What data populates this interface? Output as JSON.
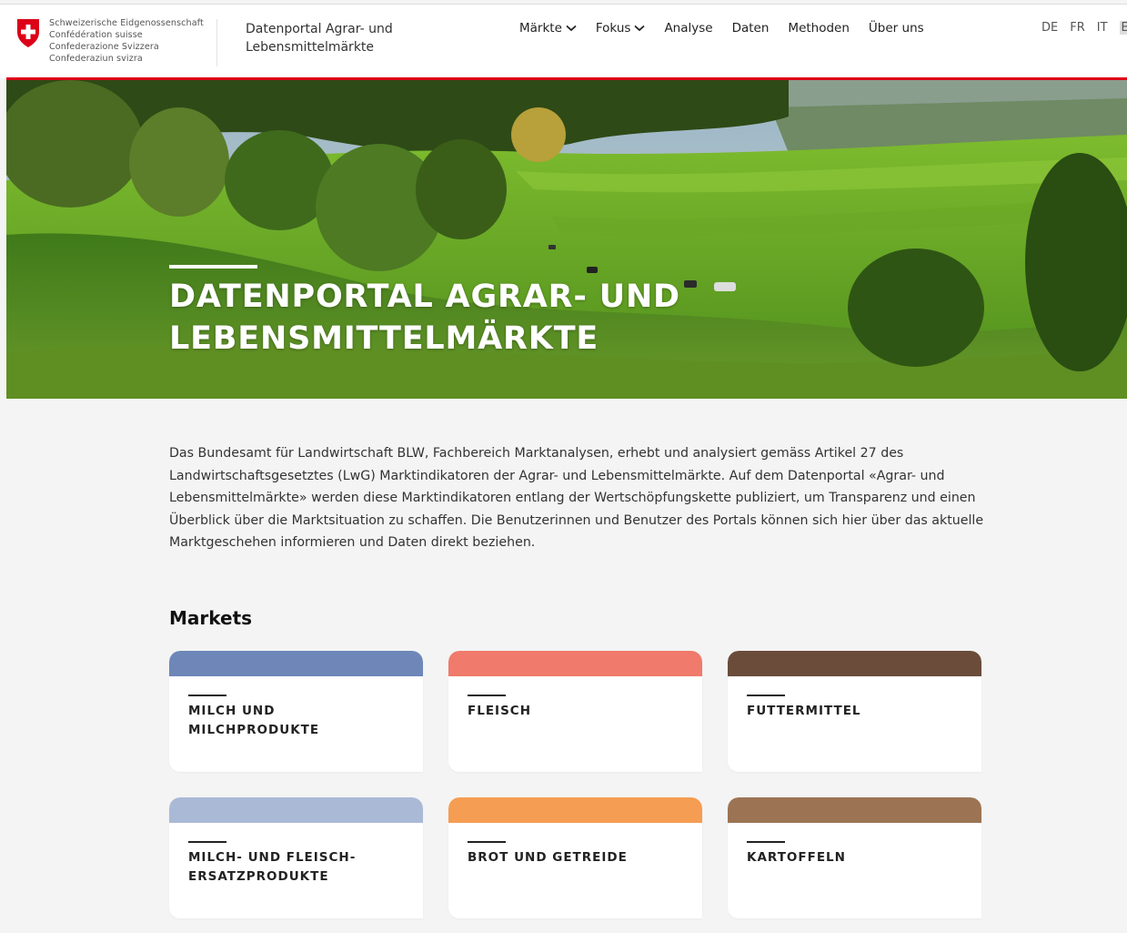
{
  "header": {
    "confederation_lines": [
      "Schweizerische Eidgenossenschaft",
      "Confédération suisse",
      "Confederazione Svizzera",
      "Confederaziun svizra"
    ],
    "portal_title": "Datenportal Agrar- und Lebensmittelmärkte",
    "nav": [
      {
        "label": "Märkte",
        "dropdown": true
      },
      {
        "label": "Fokus",
        "dropdown": true
      },
      {
        "label": "Analyse",
        "dropdown": false
      },
      {
        "label": "Daten",
        "dropdown": false
      },
      {
        "label": "Methoden",
        "dropdown": false
      },
      {
        "label": "Über uns",
        "dropdown": false
      }
    ],
    "languages": [
      "DE",
      "FR",
      "IT",
      "EN"
    ],
    "accent_color": "#dc0018"
  },
  "hero": {
    "title_line1": "Datenportal Agrar- und",
    "title_line2": "Lebensmittelmärkte"
  },
  "intro": {
    "text": "Das Bundesamt für Landwirtschaft BLW, Fachbereich Marktanalysen, erhebt und analysiert gemäss Artikel 27 des Landwirtschaftsgesetztes (LwG) Marktindikatoren der Agrar- und Lebensmittelmärkte. Auf dem Datenportal «Agrar- und Lebensmittelmärkte» werden diese Marktindikatoren entlang der Wertschöpfungskette publiziert, um Transparenz und einen Überblick über die Marktsituation zu schaffen. Die Benutzerinnen und Benutzer des Portals können sich hier über das aktuelle Marktgeschehen informieren und Daten direkt beziehen."
  },
  "markets": {
    "heading": "Markets",
    "cards": [
      {
        "label": "Milch und Milchprodukte",
        "color": "#6e87b8"
      },
      {
        "label": "Fleisch",
        "color": "#f07a6b"
      },
      {
        "label": "Futtermittel",
        "color": "#6b4c3b"
      },
      {
        "label": "Milch- und Fleisch-ersatzprodukte",
        "color": "#aab9d6"
      },
      {
        "label": "Brot und Getreide",
        "color": "#f59d52"
      },
      {
        "label": "Kartoffeln",
        "color": "#9c7454"
      }
    ]
  }
}
